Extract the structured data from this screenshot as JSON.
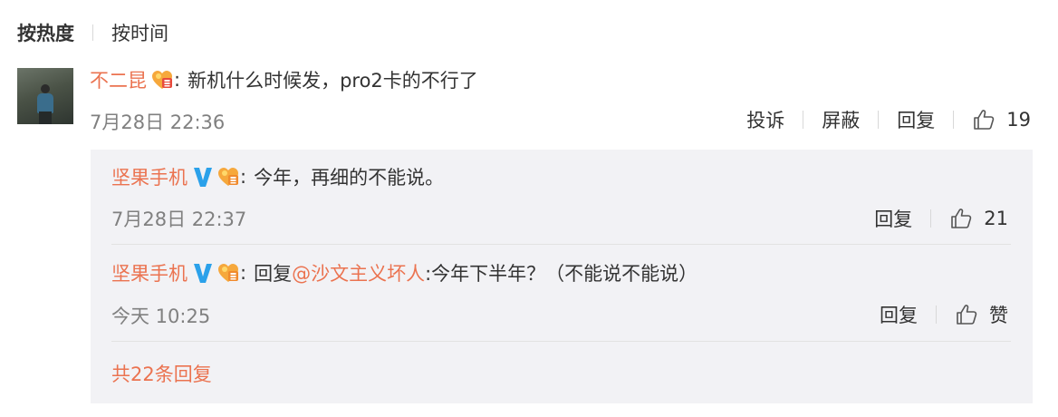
{
  "sort": {
    "hot_label": "按热度",
    "time_label": "按时间"
  },
  "comment": {
    "username": "不二昆",
    "colon": ":",
    "text": "新机什么时候发，pro2卡的不行了",
    "time": "7月28日 22:36",
    "actions": {
      "report": "投诉",
      "block": "屏蔽",
      "reply": "回复",
      "likes": "19"
    }
  },
  "replies": [
    {
      "username": "坚果手机",
      "colon": ":",
      "text": "今年，再细的不能说。",
      "time": "7月28日 22:37",
      "reply_label": "回复",
      "likes": "21"
    },
    {
      "username": "坚果手机",
      "colon": ":",
      "prefix": "回复",
      "mention": "@沙文主义坏人",
      "text": ":今年下半年？（不能说不能说）",
      "time": "今天 10:25",
      "reply_label": "回复",
      "likes": "赞"
    }
  ],
  "more_replies": "共22条回复",
  "colors": {
    "accent": "#eb7350",
    "verified": "#2ba1ea",
    "box_bg": "#f2f2f5"
  },
  "icons": {
    "like": "thumbs-up-icon",
    "verified": "verified-v-icon",
    "fan_badge": "fan-badge-icon"
  }
}
